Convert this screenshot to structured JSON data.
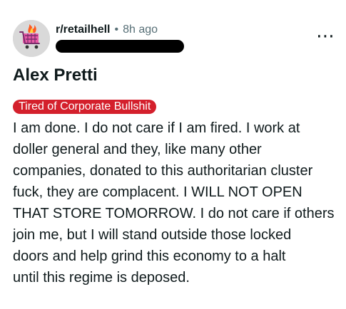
{
  "post": {
    "subreddit": "r/retailhell",
    "time": "8h ago",
    "separator": "•",
    "more_icon": "⋯",
    "title": "Alex Pretti",
    "flair": "Tired of Corporate Bullshit",
    "body_lines": [
      "I am done. I do not care if I am fired. I work at",
      "doller general and they, like many other",
      "companies, donated to this authoritarian cluster",
      "fuck, they are complacent. I WILL NOT OPEN",
      "THAT STORE TOMORROW. I do not care if others",
      "join me, but I will stand outside those locked",
      "doors and help grind this economy to a halt",
      "until this regime is deposed."
    ]
  },
  "colors": {
    "flair_bg": "#d4202c",
    "text": "#0f1a1c",
    "muted": "#576f76",
    "redaction": "#000000"
  },
  "icons": {
    "avatar": "subreddit-avatar-shopping-cart-fire",
    "more": "more-options-icon"
  }
}
